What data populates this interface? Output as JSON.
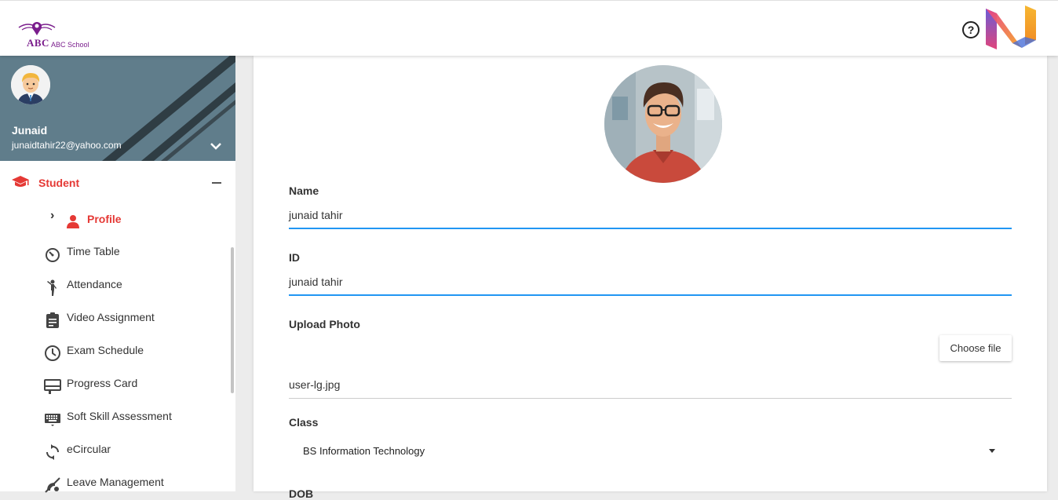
{
  "header": {
    "logo_abbr": "ABC",
    "logo_name": "ABC School",
    "help_icon": "help-circle-icon",
    "help_glyph": "?"
  },
  "user": {
    "name": "Junaid",
    "email": "junaidtahir22@yahoo.com"
  },
  "sidebar": {
    "group_label": "Student",
    "group_icon": "graduation-cap-icon",
    "active_item": {
      "label": "Profile",
      "icon": "person-icon",
      "arrow": "›"
    },
    "items": [
      {
        "label": "Time Table",
        "icon": "timer-icon"
      },
      {
        "label": "Attendance",
        "icon": "person-raise-hand-icon"
      },
      {
        "label": "Video Assignment",
        "icon": "clipboard-icon"
      },
      {
        "label": "Exam Schedule",
        "icon": "clock-icon"
      },
      {
        "label": "Progress Card",
        "icon": "card-icon"
      },
      {
        "label": "Soft Skill Assessment",
        "icon": "keyboard-icon"
      },
      {
        "label": "eCircular",
        "icon": "refresh-icon"
      },
      {
        "label": "Leave Management",
        "icon": "leave-icon"
      }
    ]
  },
  "form": {
    "name_label": "Name",
    "name_value": "junaid tahir",
    "id_label": "ID",
    "id_value": "junaid tahir",
    "upload_label": "Upload Photo",
    "choose_file": "Choose file",
    "file_name": "user-lg.jpg",
    "class_label": "Class",
    "class_value": "BS Information Technology",
    "dob_label": "DOB"
  },
  "colors": {
    "accent_red": "#e53935",
    "focus_blue": "#2196f3",
    "user_panel": "#607d8b"
  }
}
